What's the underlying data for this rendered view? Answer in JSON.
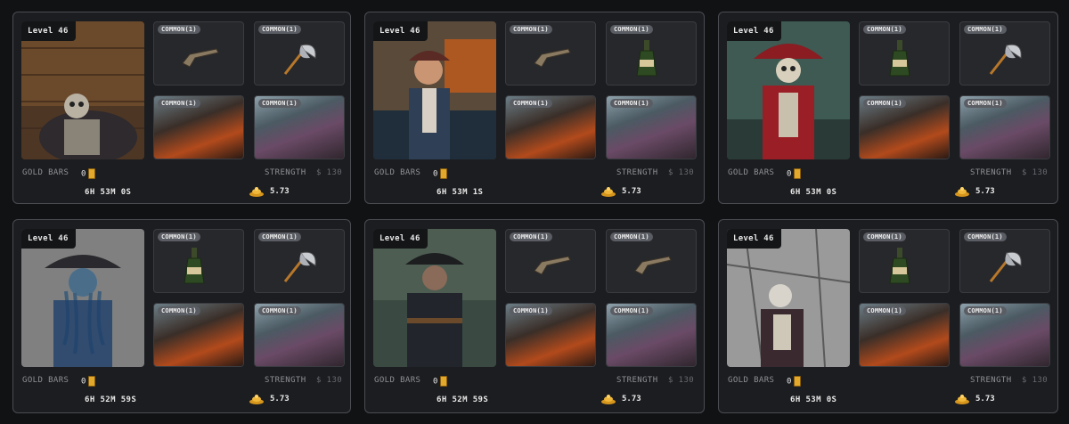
{
  "cards": [
    {
      "level": "Level 46",
      "items": [
        "COMMON(1)",
        "COMMON(1)",
        "COMMON(1)",
        "COMMON(1)"
      ],
      "item_icons": [
        "pistol-icon",
        "axe-icon",
        "ship-battle-image",
        "pirate-crew-image"
      ],
      "gold_label": "GOLD BARS",
      "gold_value": "0",
      "strength_label": "STRENGTH",
      "strength_value": "$ 130",
      "timer": "6H 53M 0S",
      "reward": "5.73",
      "portrait": "skeleton-pirate-portrait"
    },
    {
      "level": "Level 46",
      "items": [
        "COMMON(1)",
        "COMMON(1)",
        "COMMON(1)",
        "COMMON(1)"
      ],
      "item_icons": [
        "pistol-icon",
        "bottle-icon",
        "ship-battle-image",
        "pirate-crew-image"
      ],
      "gold_label": "GOLD BARS",
      "gold_value": "0",
      "strength_label": "STRENGTH",
      "strength_value": "$ 130",
      "timer": "6H 53M 1S",
      "reward": "5.73",
      "portrait": "pirate-captain-portrait"
    },
    {
      "level": "Level 46",
      "items": [
        "COMMON(1)",
        "COMMON(1)",
        "COMMON(1)",
        "COMMON(1)"
      ],
      "item_icons": [
        "bottle-icon",
        "axe-icon",
        "ship-battle-image",
        "pirate-crew-image"
      ],
      "gold_label": "GOLD BARS",
      "gold_value": "0",
      "strength_label": "STRENGTH",
      "strength_value": "$ 130",
      "timer": "6H 53M 0S",
      "reward": "5.73",
      "portrait": "red-skeleton-captain-portrait"
    },
    {
      "level": "Level 46",
      "items": [
        "COMMON(1)",
        "COMMON(1)",
        "COMMON(1)",
        "COMMON(1)"
      ],
      "item_icons": [
        "bottle-icon",
        "axe-icon",
        "ship-battle-image",
        "pirate-crew-image"
      ],
      "gold_label": "GOLD BARS",
      "gold_value": "0",
      "strength_label": "STRENGTH",
      "strength_value": "$ 130",
      "timer": "6H 52M 59S",
      "reward": "5.73",
      "portrait": "tentacle-captain-portrait"
    },
    {
      "level": "Level 46",
      "items": [
        "COMMON(1)",
        "COMMON(1)",
        "COMMON(1)",
        "COMMON(1)"
      ],
      "item_icons": [
        "pistol-icon",
        "pistol-icon",
        "ship-battle-image",
        "pirate-crew-image"
      ],
      "gold_label": "GOLD BARS",
      "gold_value": "0",
      "strength_label": "STRENGTH",
      "strength_value": "$ 130",
      "timer": "6H 52M 59S",
      "reward": "5.73",
      "portrait": "undead-pirate-portrait"
    },
    {
      "level": "Level 46",
      "items": [
        "COMMON(1)",
        "COMMON(1)",
        "COMMON(1)",
        "COMMON(1)"
      ],
      "item_icons": [
        "bottle-icon",
        "axe-icon",
        "ship-battle-image",
        "pirate-crew-image"
      ],
      "gold_label": "GOLD BARS",
      "gold_value": "0",
      "strength_label": "STRENGTH",
      "strength_value": "$ 130",
      "timer": "6H 53M 0S",
      "reward": "5.73",
      "portrait": "grayscale-skeleton-portrait"
    }
  ],
  "colors": {
    "background": "#111214",
    "card": "#1c1d20",
    "card_border": "#4a4c52",
    "gold": "#e2a92c",
    "rarity_pill": "#5a5d63"
  }
}
